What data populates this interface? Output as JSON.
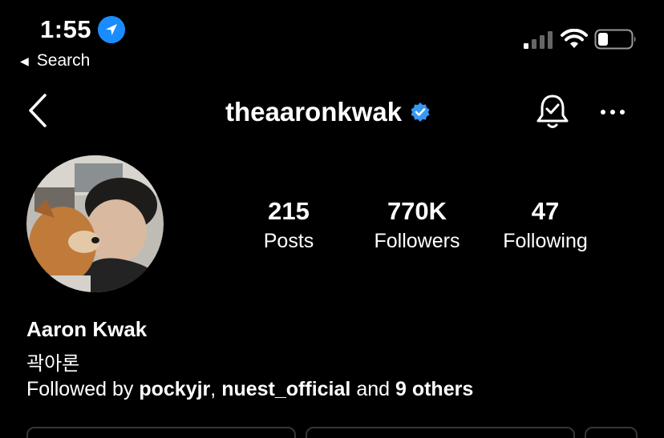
{
  "status_bar": {
    "time": "1:55",
    "back_label": "Search",
    "icons": [
      "location-arrow-icon",
      "cellular-signal-icon",
      "wifi-icon",
      "battery-icon"
    ],
    "accent_color": "#1a8cff"
  },
  "header": {
    "username": "theaaronkwak",
    "verified": true,
    "icons": [
      "back-chevron-icon",
      "verified-badge-icon",
      "notification-bell-icon",
      "more-options-icon"
    ]
  },
  "stats": {
    "posts": {
      "value": "215",
      "label": "Posts"
    },
    "followers": {
      "value": "770K",
      "label": "Followers"
    },
    "following": {
      "value": "47",
      "label": "Following"
    }
  },
  "bio": {
    "name": "Aaron Kwak",
    "korean_name": "곽아론",
    "followed_by_prefix": "Followed by",
    "followed_by_user1": "pockyjr",
    "separator": ",",
    "followed_by_user2": "nuest_official",
    "and_text": "and",
    "others": "9 others"
  }
}
